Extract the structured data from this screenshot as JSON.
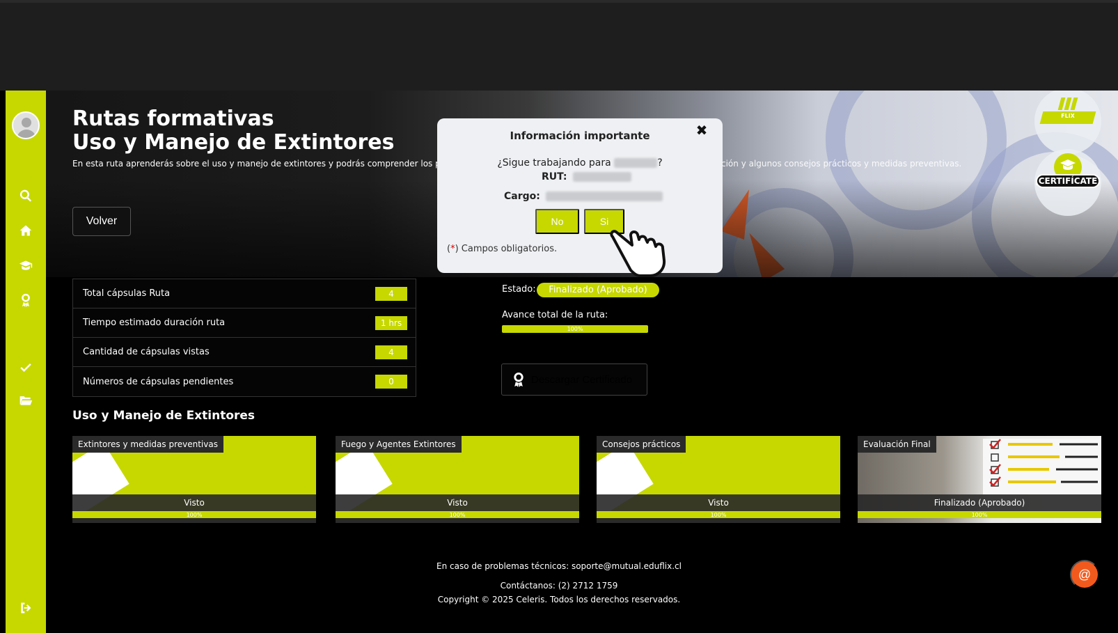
{
  "hero": {
    "title_line1": "Rutas formativas",
    "title_line2": "Uso y Manejo de Extintores",
    "description_left": "En esta ruta aprenderás sobre el uso y manejo de extintores y podrás comprender los princ",
    "description_right": "ción y algunos consejos prácticos y medidas preventivas.",
    "back_button": "Volver",
    "certificate_badge": "¡CERTIFÍCATE!",
    "flix_label": "FLIX"
  },
  "modal": {
    "title": "Información importante",
    "close_symbol": "✖",
    "question_prefix": "¿Sigue trabajando para",
    "question_suffix": "?",
    "rut_label": "RUT:",
    "cargo_label": "Cargo:",
    "no_button": "No",
    "yes_button": "Si",
    "note_star": "*",
    "note_open": "(",
    "note_text": ") Campos obligatorios."
  },
  "stats": [
    {
      "label": "Total cápsulas Ruta",
      "value": "4"
    },
    {
      "label": "Tiempo estimado duración ruta",
      "value": "1 hrs"
    },
    {
      "label": "Cantidad de cápsulas vistas",
      "value": "4"
    },
    {
      "label": "Números de cápsulas pendientes",
      "value": "0"
    }
  ],
  "status": {
    "estado_label": "Estado:",
    "estado_value": "Finalizado (Aprobado)",
    "avance_label": "Avance total de la ruta:",
    "avance_value": "100%",
    "avance_fraction": 1.0,
    "certificate_button": "Descargar Certificado"
  },
  "section_title": "Uso y Manejo de Extintores",
  "cards": [
    {
      "tag": "Extintores y medidas preventivas",
      "status": "Visto",
      "progress": "100%"
    },
    {
      "tag": "Fuego y Agentes Extintores",
      "status": "Visto",
      "progress": "100%"
    },
    {
      "tag": "Consejos prácticos",
      "status": "Visto",
      "progress": "100%"
    },
    {
      "tag": "Evaluación Final",
      "status": "Finalizado (Aprobado)",
      "progress": "100%"
    }
  ],
  "footer": {
    "support": "En caso de problemas técnicos: soporte@mutual.eduflix.cl",
    "contact": "Contáctanos: (2) 2712 1759",
    "copyright": "Copyright © 2025 Celeris. Todos los derechos reservados."
  },
  "chat_button": "@",
  "colors": {
    "accent": "#c6d800",
    "chat": "#f25a1d",
    "background": "#000000"
  },
  "icons": [
    "user-avatar-icon",
    "search-icon",
    "home-icon",
    "graduation-cap-icon",
    "award-icon",
    "check-icon",
    "folder-open-icon",
    "logout-icon",
    "certificate-icon",
    "close-icon",
    "hand-pointer-icon"
  ]
}
